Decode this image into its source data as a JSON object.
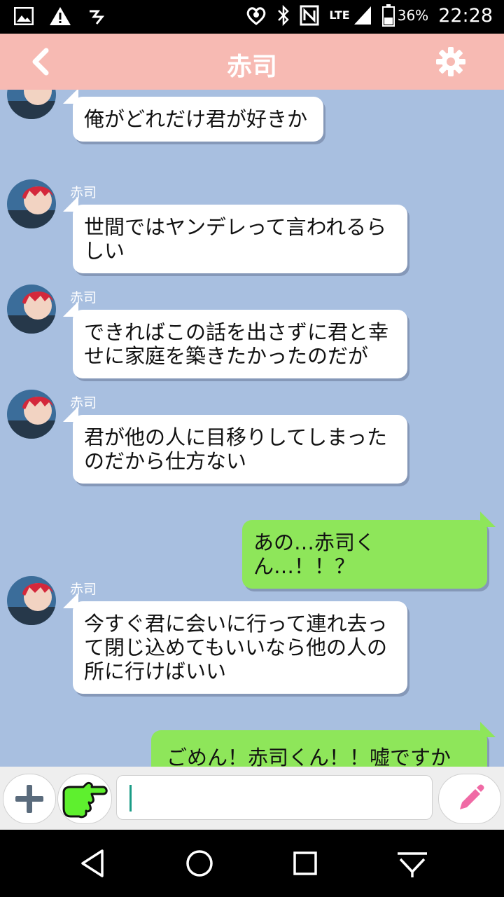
{
  "status": {
    "battery_percent": "36%",
    "time": "22:28",
    "network": "LTE"
  },
  "header": {
    "title": "赤司",
    "back_icon": "back-chevron-icon",
    "settings_icon": "gear-icon"
  },
  "messages": [
    {
      "side": "left",
      "sender": "",
      "show_avatar": true,
      "lines": [
        "俺がどれだけ君が好きか"
      ]
    },
    {
      "side": "left",
      "sender": "赤司",
      "show_avatar": true,
      "lines": [
        "世間ではヤンデレって言われるら",
        "しい"
      ]
    },
    {
      "side": "left",
      "sender": "赤司",
      "show_avatar": true,
      "lines": [
        "できればこの話を出さずに君と幸",
        "せに家庭を築きたかったのだが"
      ]
    },
    {
      "side": "left",
      "sender": "赤司",
      "show_avatar": true,
      "lines": [
        "君が他の人に目移りしてしまった",
        "のだから仕方ない"
      ]
    },
    {
      "side": "right",
      "sender": "",
      "show_avatar": false,
      "lines": [
        "あの…赤司くん…！！？"
      ]
    },
    {
      "side": "left",
      "sender": "赤司",
      "show_avatar": true,
      "lines": [
        "今すぐ君に会いに行って連れ去っ",
        "て閉じ込めてもいいなら他の人の",
        "所に行けばいい"
      ]
    },
    {
      "side": "right",
      "sender": "",
      "show_avatar": false,
      "lines": [
        "ごめん！赤司くん！！嘘ですか"
      ]
    }
  ],
  "input": {
    "value": "",
    "placeholder": ""
  },
  "colors": {
    "header": "#f7bab3",
    "chat_bg": "#a8bfe0",
    "my_bubble": "#8ee65a",
    "their_bubble": "#ffffff"
  }
}
